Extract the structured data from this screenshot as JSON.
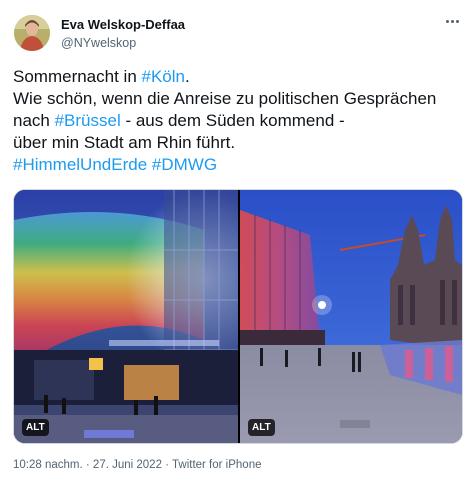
{
  "author": {
    "display_name": "Eva Welskop-Deffaa",
    "handle": "@NYwelskop"
  },
  "tweet": {
    "lines": [
      [
        {
          "t": "Sommernacht in "
        },
        {
          "t": "#Köln",
          "tag": true
        },
        {
          "t": "."
        }
      ],
      [
        {
          "t": "Wie schön, wenn die Anreise zu politischen Gesprächen"
        }
      ],
      [
        {
          "t": "nach "
        },
        {
          "t": "#Brüssel",
          "tag": true
        },
        {
          "t": " - aus dem Süden kommend -"
        }
      ],
      [
        {
          "t": "über min Stadt am Rhin führt."
        }
      ],
      [
        {
          "t": "#HimmelUndErde",
          "tag": true
        },
        {
          "t": " "
        },
        {
          "t": "#DMWG",
          "tag": true
        }
      ]
    ]
  },
  "media": {
    "left_alt_badge": "ALT",
    "right_alt_badge": "ALT"
  },
  "meta": {
    "time": "10:28 nachm.",
    "separator1": " · ",
    "date": "27. Juni 2022",
    "separator2": " · ",
    "source": "Twitter for iPhone"
  },
  "colors": {
    "link": "#1d9bf0",
    "text": "#0f1419",
    "secondary": "#536471",
    "border": "#cfd9de"
  },
  "icons": {
    "more": "more-horizontal-icon"
  }
}
